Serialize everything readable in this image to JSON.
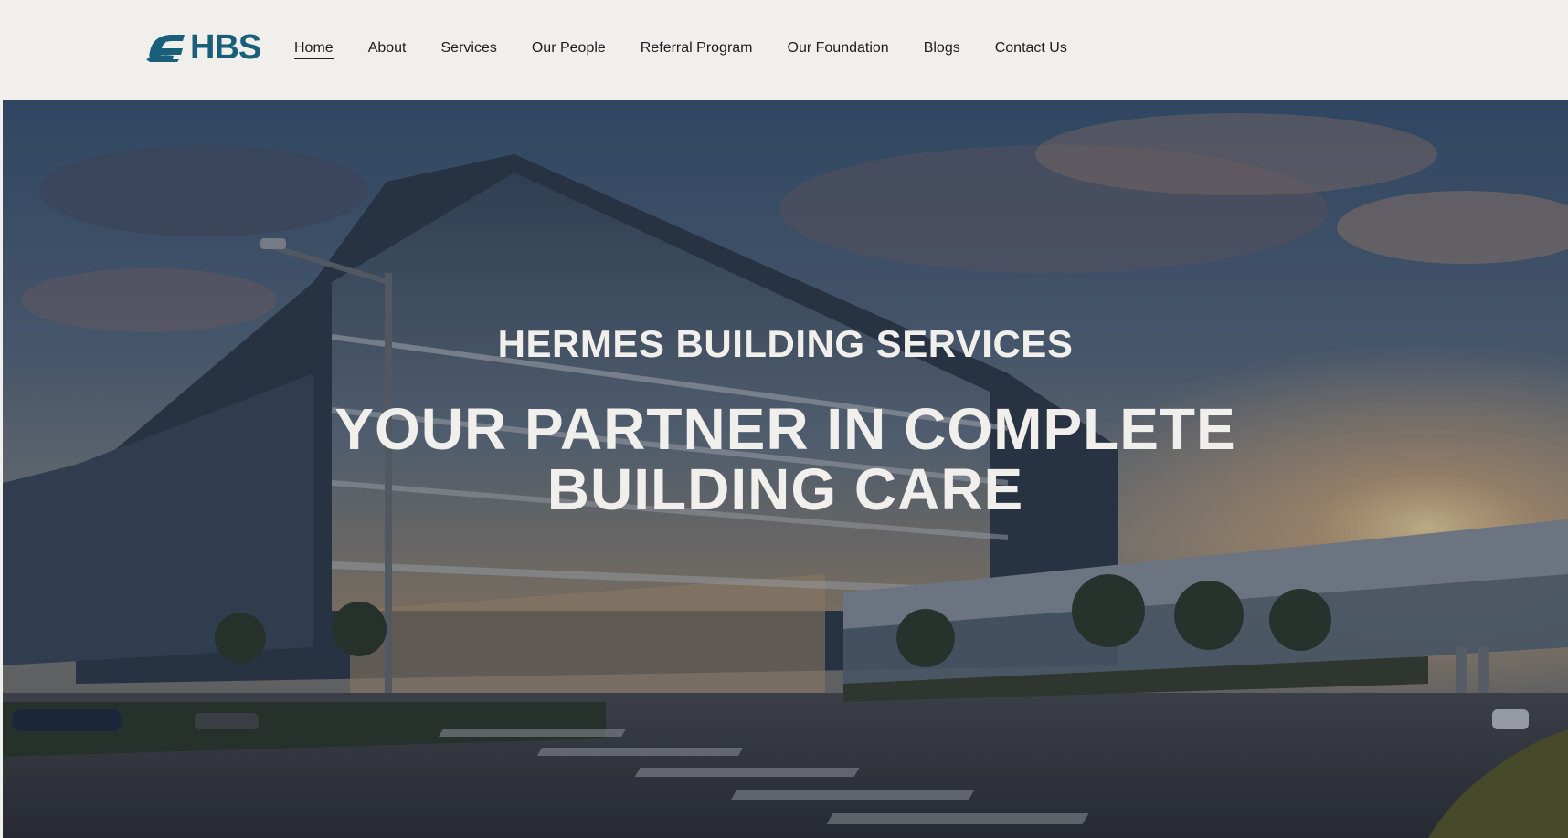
{
  "brand": {
    "logo_text": "HBS",
    "logo_mark_letters": "LE",
    "color": "#1a5f7a"
  },
  "nav": {
    "items": [
      {
        "label": "Home",
        "active": true
      },
      {
        "label": "About",
        "active": false
      },
      {
        "label": "Services",
        "active": false
      },
      {
        "label": "Our People",
        "active": false
      },
      {
        "label": "Referral Program",
        "active": false
      },
      {
        "label": "Our Foundation",
        "active": false
      },
      {
        "label": "Blogs",
        "active": false
      },
      {
        "label": "Contact Us",
        "active": false
      }
    ]
  },
  "hero": {
    "subtitle": "HERMES BUILDING SERVICES",
    "title_line1": "YOUR PARTNER IN COMPLETE",
    "title_line2": "BUILDING CARE",
    "text_color": "#f0efeb"
  },
  "colors": {
    "header_bg": "#f0efeb",
    "nav_text": "#1d1d1d",
    "accent": "#1a5f7a"
  }
}
